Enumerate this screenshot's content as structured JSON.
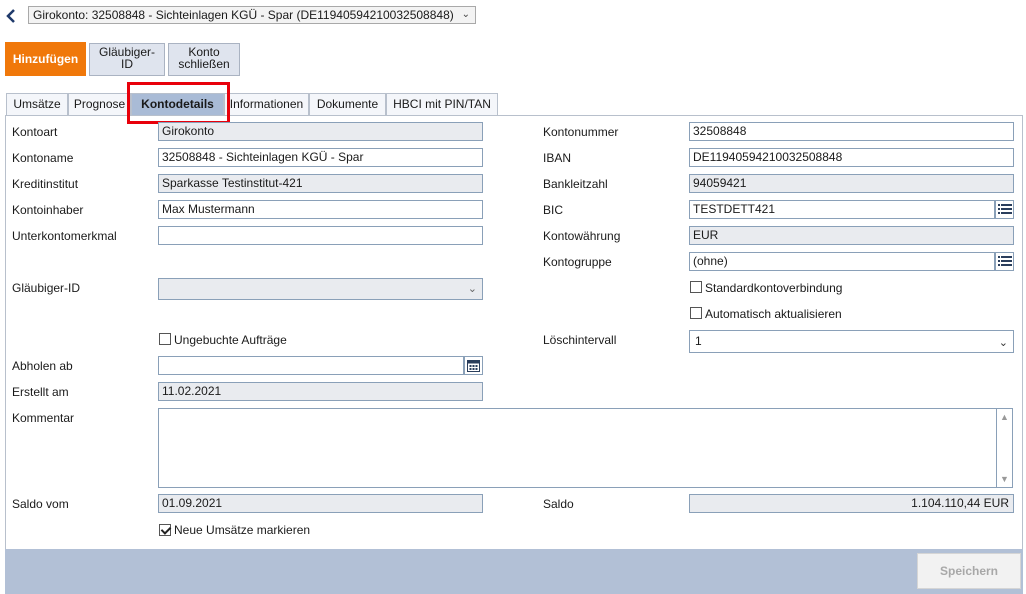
{
  "header": {
    "account_selector": "Girokonto: 32508848 - Sichteinlagen KGÜ - Spar (DE11940594210032508848)"
  },
  "actions": {
    "add": "Hinzufügen",
    "creditor_id": "Gläubiger-\nID",
    "close_account": "Konto\nschließen"
  },
  "tabs": [
    {
      "label": "Umsätze"
    },
    {
      "label": "Prognose"
    },
    {
      "label": "Kontodetails"
    },
    {
      "label": "Informationen"
    },
    {
      "label": "Dokumente"
    },
    {
      "label": "HBCI mit PIN/TAN"
    }
  ],
  "form": {
    "kontoart": {
      "label": "Kontoart",
      "value": "Girokonto"
    },
    "kontoname": {
      "label": "Kontoname",
      "value": "32508848 - Sichteinlagen KGÜ - Spar"
    },
    "kreditinstitut": {
      "label": "Kreditinstitut",
      "value": "Sparkasse Testinstitut-421"
    },
    "kontoinhaber": {
      "label": "Kontoinhaber",
      "value": "Max Mustermann"
    },
    "unterkontomerkmal": {
      "label": "Unterkontomerkmal",
      "value": ""
    },
    "glaeubiger_id": {
      "label": "Gläubiger-ID",
      "value": ""
    },
    "ungebuchte": {
      "label": "Ungebuchte Aufträge",
      "checked": false
    },
    "abholen_ab": {
      "label": "Abholen ab",
      "value": ""
    },
    "erstellt_am": {
      "label": "Erstellt am",
      "value": "11.02.2021"
    },
    "kommentar": {
      "label": "Kommentar",
      "value": ""
    },
    "saldo_vom": {
      "label": "Saldo vom",
      "value": "01.09.2021"
    },
    "neue_umsaetze": {
      "label": "Neue Umsätze markieren",
      "checked": true
    },
    "kontonummer": {
      "label": "Kontonummer",
      "value": "32508848"
    },
    "iban": {
      "label": "IBAN",
      "value": "DE11940594210032508848"
    },
    "bankleitzahl": {
      "label": "Bankleitzahl",
      "value": "94059421"
    },
    "bic": {
      "label": "BIC",
      "value": "TESTDETT421"
    },
    "kontowaehrung": {
      "label": "Kontowährung",
      "value": "EUR"
    },
    "kontogruppe": {
      "label": "Kontogruppe",
      "value": "(ohne)"
    },
    "standard": {
      "label": "Standardkontoverbindung",
      "checked": false
    },
    "auto_update": {
      "label": "Automatisch aktualisieren",
      "checked": false
    },
    "loeschintervall": {
      "label": "Löschintervall",
      "value": "1"
    },
    "saldo": {
      "label": "Saldo",
      "value": "1.104.110,44 EUR"
    }
  },
  "footer": {
    "save": "Speichern"
  },
  "colors": {
    "accent": "#f0780a",
    "active_tab": "#a9bbd6",
    "highlight": "#e8000b"
  },
  "icons": [
    "back-arrow-icon",
    "chevron-down-icon",
    "list-icon",
    "calendar-icon",
    "checkmark-icon"
  ]
}
